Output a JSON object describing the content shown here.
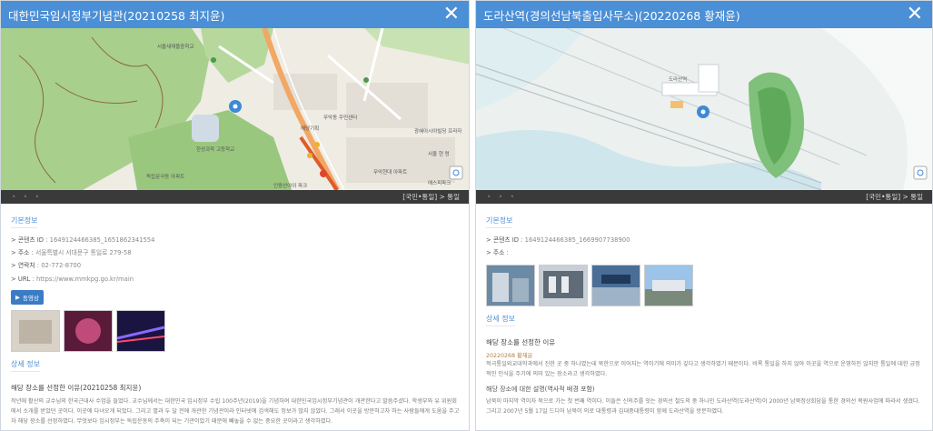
{
  "panels": [
    {
      "title": "대한민국임시정부기념관(20210258 최지윤)",
      "close_label": "✕",
      "map_footer": "[국민•통일] > 통일",
      "map_labels": {
        "school": "서울새재뜰중학교",
        "h1": "홍제센트럴아이파크",
        "h2": "무악동 주민센터",
        "h3": "무악현대 아파트",
        "h4": "한성과학 고등학교",
        "h5": "독립문극동 아파트",
        "h6": "인왕산아이 파크",
        "h7": "에스피파크",
        "h8": "서울 현 렁",
        "h9": "해당기획",
        "h10": "광혜아시아빌딩 프라자"
      },
      "basic_info_title": "기본정보",
      "info": [
        {
          "key": "> 콘텐츠 ID",
          "val": " : 1649124466385_1651862341554"
        },
        {
          "key": "> 주소",
          "val": " : 서울특별시 서대문구 통일로 279-58"
        },
        {
          "key": "> 연락처",
          "val": " : 02-772-8700"
        },
        {
          "key": "> URL",
          "val": " : https://www.mmkpg.go.kr/main"
        }
      ],
      "video_label": "동영상",
      "detail_title": "상세 정보",
      "reason_title": "해당 장소를 선정한 이유(20210258 최지윤)",
      "reason_text": "작년에 활산의 교수님의 한국근대사 수업을 들었다. 교수님께서는 대한민국 임시정부 수립 100주년(2019)을 기념하여 대한민국임시정부기념관이 개관한다고 말씀주셨다. 학생부와 유 위원회에서 소개를 받았던 곳이다. 이곳에 다녀오게 되었다. 그리고 별과 두 달 전에 개관한 기념관이라 인터넷에 검색해도 정보가 많지 않았다. 그래서 이곳을 방문하고자 하는 사람들에게 도움을 주고자 해당 장소를 선정하였다. 무엇보다 임시정부는 독립운동의 주축이 되는 기관이었기 때문에 빼놓을 수 없는 중요한 곳이라고 생각하였다."
    },
    {
      "title": "도라산역(경의선남북출입사무소)(20220268 황재윤)",
      "close_label": "✕",
      "map_footer": "[국민•통일] > 통일",
      "map_labels": {
        "station": "도라산역"
      },
      "basic_info_title": "기본정보",
      "info": [
        {
          "key": "> 콘텐츠 ID",
          "val": " : 1649124466385_1669907738900"
        },
        {
          "key": "> 주소",
          "val": " : "
        }
      ],
      "detail_title": "상세 정보",
      "reason_title": "해당 장소를 선정한 이유",
      "reason_author": "20220268 황재윤",
      "reason_text": "적극통일외교대학과에서 진한 곳 중 하나였는데 북한으로 이어지는 역이기에 의미가 깊다고 생각하였기 때문이다. 비록 통일을 하지 않아 이곳을 역으로 운영하진 않지만 통일에 대한 긍정적인 인식을 주기에 의미 있는 장소라고 생각하였다.",
      "sub_title": "해당 장소에 대한 설명(역사적 배경 포함)",
      "sub_text": "남북이 마지막 역이자 북으로 가는 첫 번째 역이다. 이들은 신의주를 잇는 경의선 철도의 중 하나인 도라산역(도라산역)이 2000년 남북정상회담을 통한 경의선 복원사업에 따라서 생겼다. 그리고 2007년 5월 17일 드디어 남북이 의로 대통령과 김대중대통령이 함께 도라산역을 방문하였다."
    }
  ]
}
